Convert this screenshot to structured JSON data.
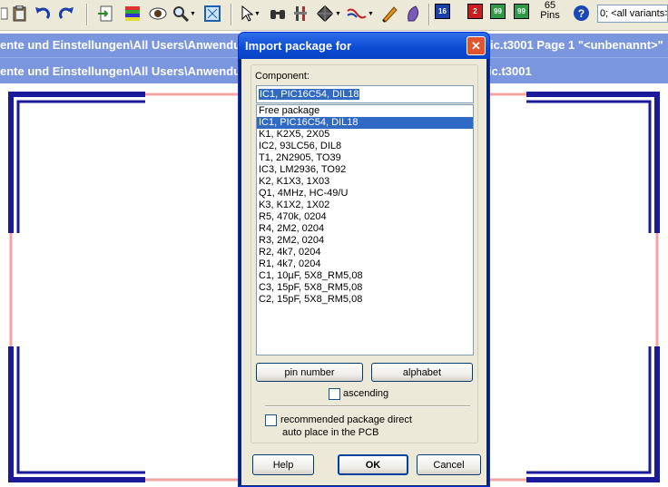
{
  "toolbar": {
    "pins_count": "65",
    "pins_label": "Pins",
    "counter_1": "16",
    "counter_2": "2",
    "counter_3": "99",
    "counter_4": "99",
    "variant_select": "0; <all variants>",
    "icons": [
      "copy-icon",
      "paste-icon",
      "undo-icon",
      "redo-icon",
      "import-icon",
      "layers-icon",
      "eye-icon",
      "zoom-icon",
      "zoom-fit-icon",
      "pointer-icon",
      "binoculars-icon",
      "tool-icon",
      "component-icon",
      "wire-icon",
      "pen-icon",
      "shape-icon",
      "help-icon"
    ]
  },
  "background_windows": {
    "bar1_left": "ente und Einstellungen\\All Users\\Anwendu",
    "bar1_right": "ic.t3001 Page 1 \"<unbenannt>\"",
    "bar2_left": "ente und Einstellungen\\All Users\\Anwendung",
    "bar2_right": "ic.t3001"
  },
  "colors": {
    "board_outline": "#f4a4a4",
    "corner_marks": "#1a1a9a",
    "title_bar": "#7a96df",
    "dialog_title": "#0a4bd4",
    "selection": "#316ac5"
  },
  "dialog": {
    "title": "Import package for",
    "component_label": "Component:",
    "component_value": "IC1, PIC16C54, DIL18",
    "list_items": [
      "Free package",
      "IC1, PIC16C54, DIL18",
      "K1, K2X5, 2X05",
      "IC2, 93LC56, DIL8",
      "T1, 2N2905, TO39",
      "IC3, LM2936, TO92",
      "K2, K1X3, 1X03",
      "Q1, 4MHz, HC-49/U",
      "K3, K1X2, 1X02",
      "R5, 470k, 0204",
      "R4, 2M2, 0204",
      "R3, 2M2, 0204",
      "R2, 4k7, 0204",
      "R1, 4k7, 0204",
      "C1, 10µF, 5X8_RM5,08",
      "C3, 15pF, 5X8_RM5,08",
      "C2, 15pF, 5X8_RM5,08"
    ],
    "selected_index": 1,
    "pin_number_button": "pin number",
    "alphabet_button": "alphabet",
    "ascending_label": "ascending",
    "recommended_line1": "recommended package direct",
    "recommended_line2": "auto place in the PCB",
    "help_button": "Help",
    "ok_button": "OK",
    "cancel_button": "Cancel"
  }
}
